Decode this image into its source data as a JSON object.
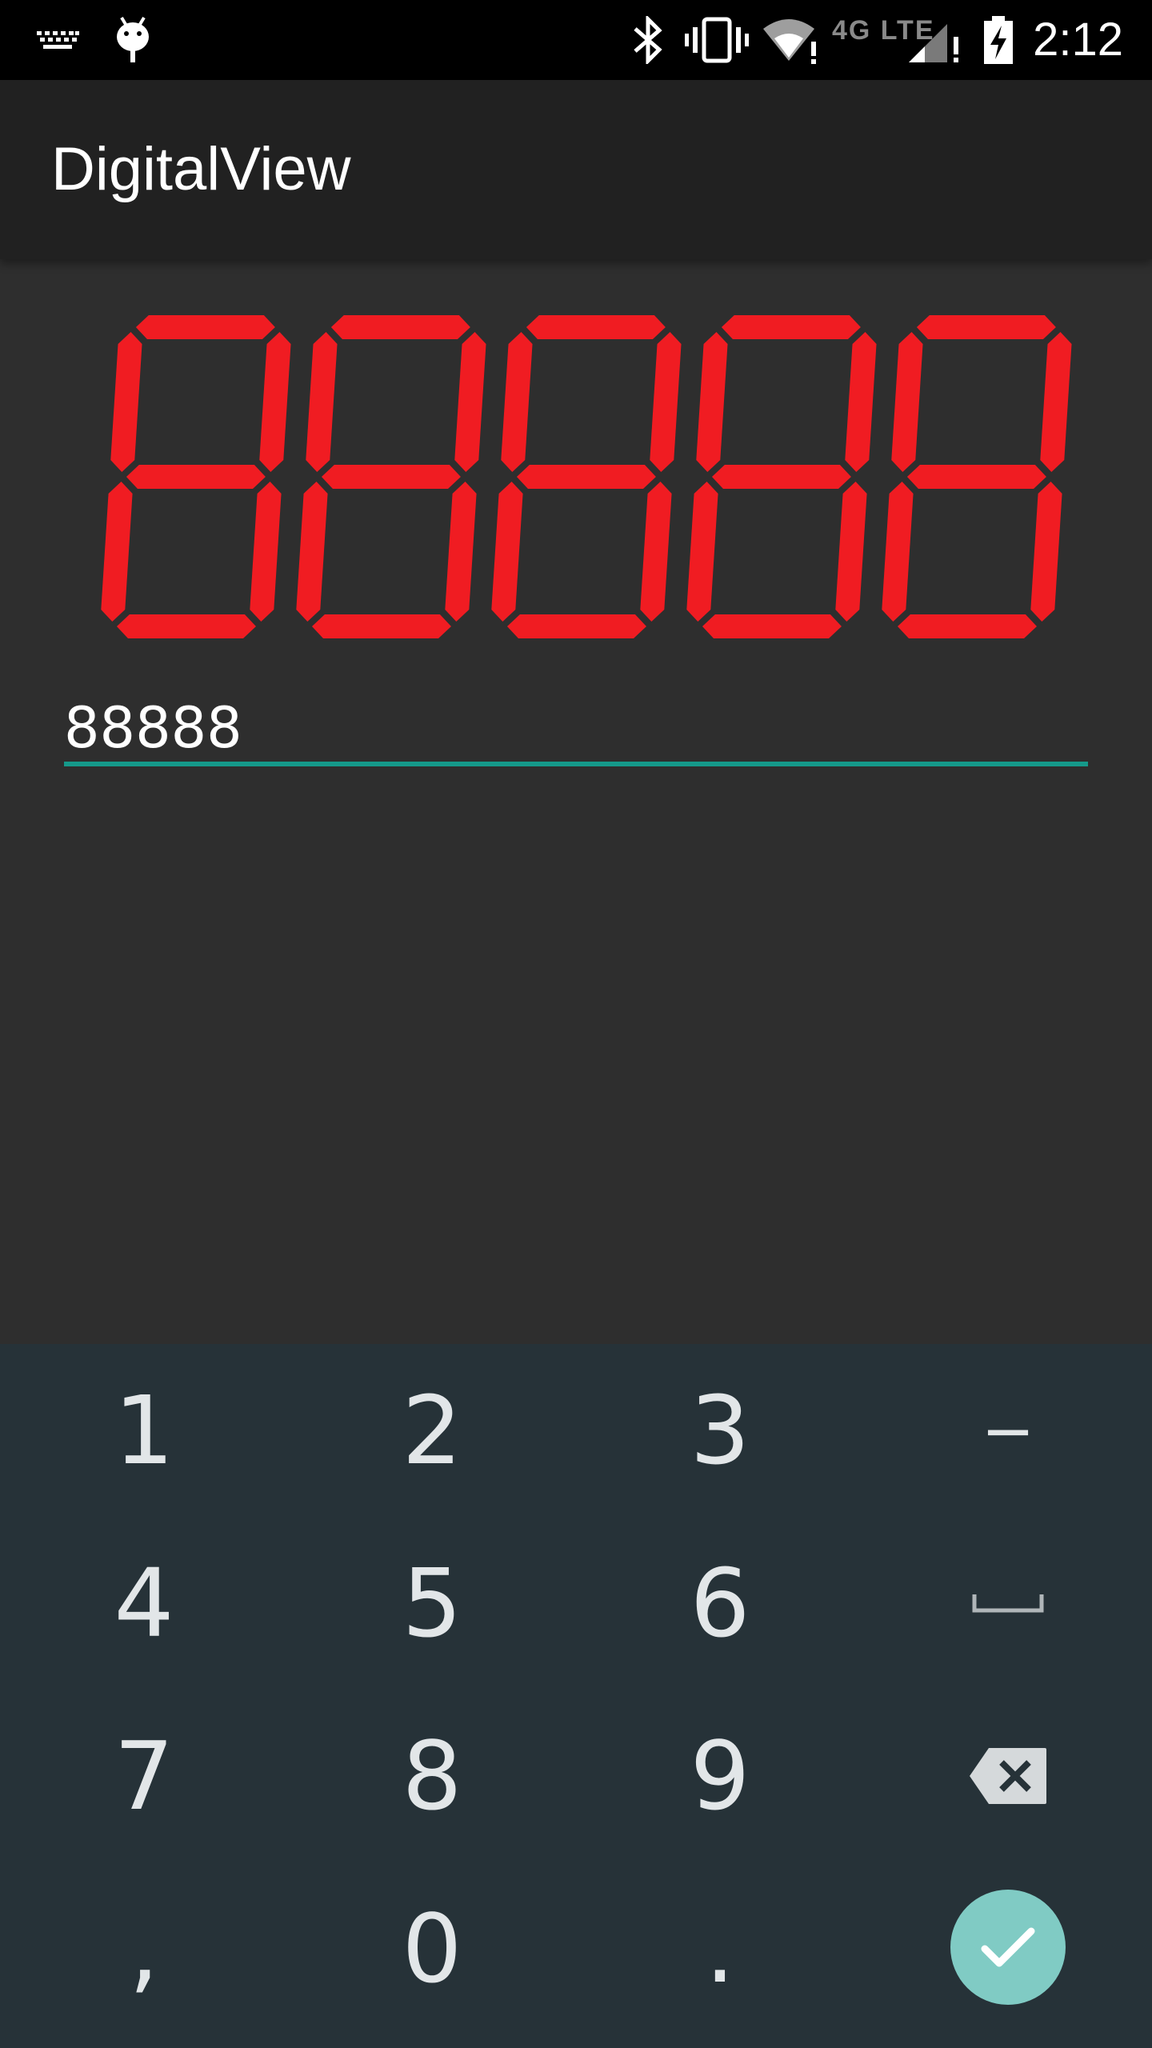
{
  "status_bar": {
    "time": "2:12",
    "network_label": "4G LTE",
    "icons": [
      "keyboard-icon",
      "android-icon",
      "bluetooth-icon",
      "vibrate-icon",
      "wifi-alert-icon",
      "lte-icon",
      "signal-alert-icon",
      "battery-charging-icon"
    ]
  },
  "app_bar": {
    "title": "DigitalView"
  },
  "display": {
    "value": "88888",
    "segment_color": "#f01c22"
  },
  "input": {
    "value": "88888",
    "underline_color": "#15998a"
  },
  "keyboard": {
    "rows": [
      [
        "1",
        "2",
        "3",
        "−"
      ],
      [
        "4",
        "5",
        "6",
        "␣"
      ],
      [
        "7",
        "8",
        "9",
        "⌫"
      ],
      [
        ",",
        "0",
        ".",
        "✓"
      ]
    ],
    "done_color": "#80cbc4"
  }
}
